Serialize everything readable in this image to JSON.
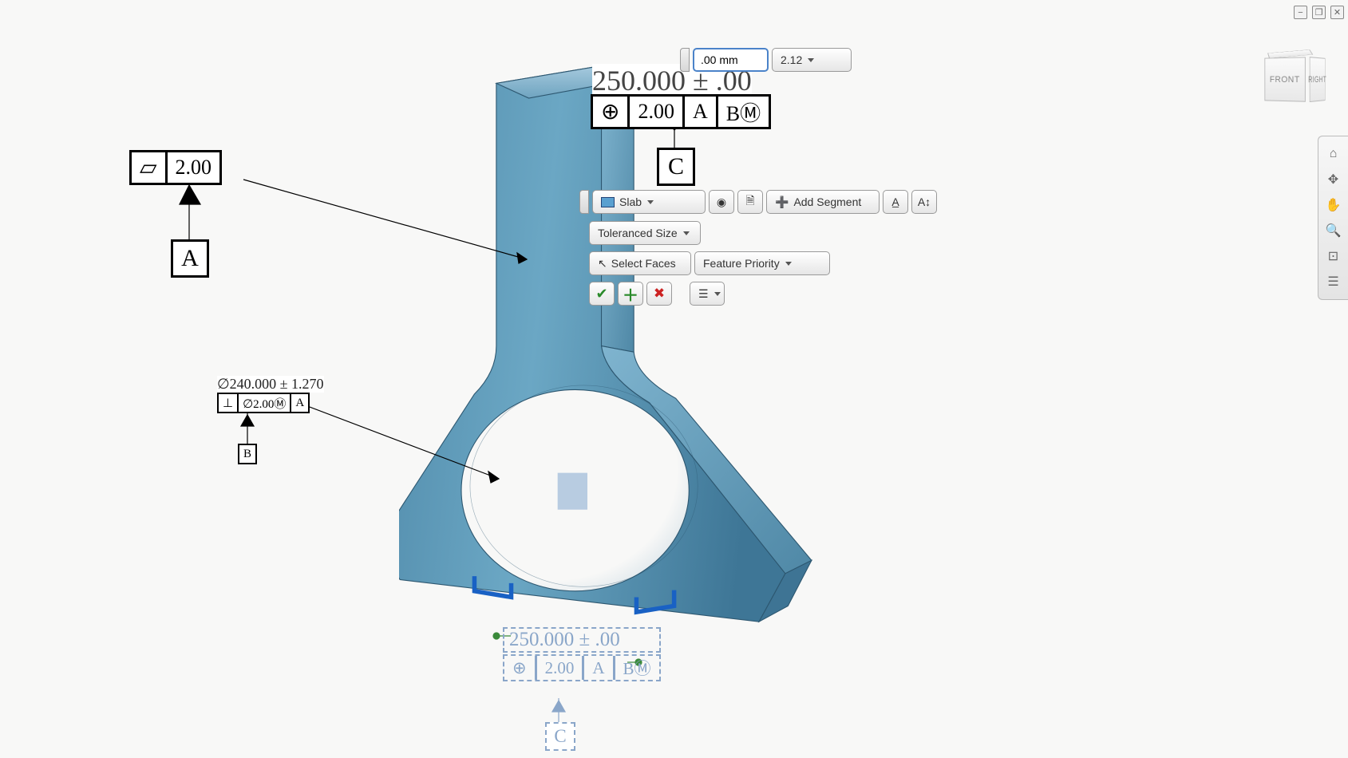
{
  "window": {
    "min": "−",
    "restore": "❐",
    "close": "✕"
  },
  "inputbar": {
    "unit": ".00 mm",
    "precision": "2.12"
  },
  "main_dim": "250.000 ± .00",
  "fcf1": {
    "sym": "⊕",
    "tol": "2.00",
    "d1": "A",
    "d2": "BⓂ"
  },
  "datum_c": "C",
  "flatness": {
    "sym": "▱",
    "tol": "2.00"
  },
  "datum_a": "A",
  "hole": {
    "dim": "∅240.000 ± 1.270",
    "sym": "⊥",
    "tol": "∅2.00Ⓜ",
    "d": "A"
  },
  "datum_b": "B",
  "tb1": {
    "type": "Slab",
    "add": "Add Segment"
  },
  "tb2": {
    "label": "Toleranced Size"
  },
  "tb3": {
    "sel": "Select Faces",
    "pri": "Feature Priority"
  },
  "ghost": {
    "dim": "250.000 ± .00",
    "sym": "⊕",
    "tol": "2.00",
    "d1": "A",
    "d2": "BⓂ",
    "c": "C"
  },
  "cube": {
    "front": "FRONT",
    "right": "RIGHT"
  },
  "icons": {
    "home": "⌂",
    "orbit": "✥",
    "pan": "✋",
    "zoom": "🔍",
    "fit": "⊡",
    "opts": "☰"
  }
}
